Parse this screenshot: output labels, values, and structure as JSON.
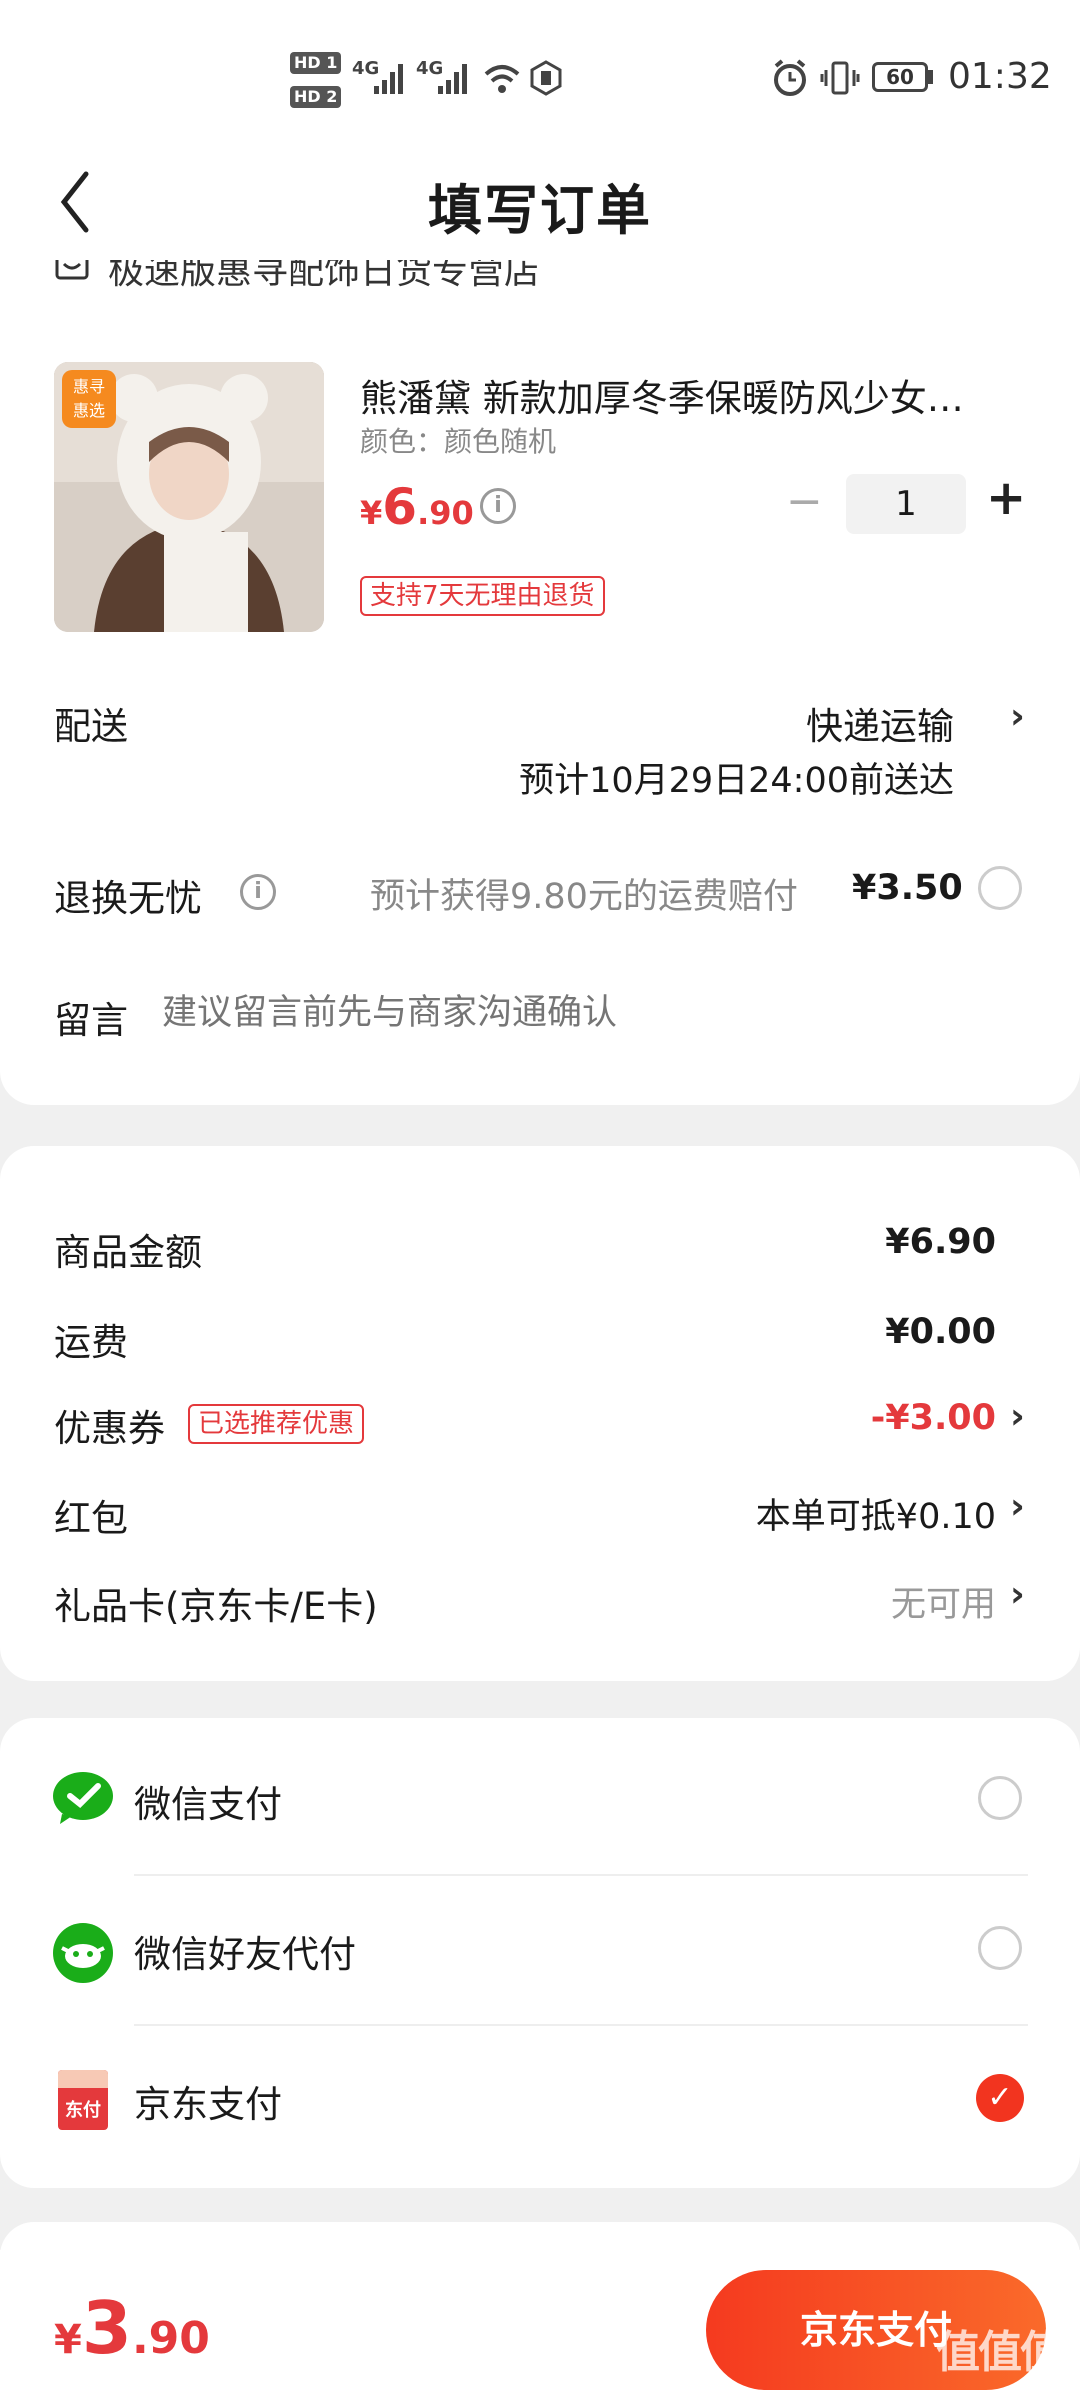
{
  "status_bar": {
    "hd1": "HD 1",
    "hd2": "HD 2",
    "net1": "4G",
    "net2": "4G",
    "battery": "60",
    "time": "01:32"
  },
  "header": {
    "title": "填写订单"
  },
  "store": {
    "name": "极速版惠寻配饰日货专营店"
  },
  "product": {
    "badge": "惠寻\n惠选",
    "name": "熊潘黛 新款加厚冬季保暖防风少女…",
    "spec": "颜色：颜色随机",
    "price_symbol": "¥",
    "price_int": "6",
    "price_dec": ".90",
    "quantity": "1",
    "minus": "−",
    "plus": "+",
    "return_tag": "支持7天无理由退货"
  },
  "delivery": {
    "label": "配送",
    "method": "快递运输",
    "eta": "预计10月29日24:00前送达"
  },
  "return_worry": {
    "label": "退换无忧",
    "desc": "预计获得9.80元的运费赔付",
    "price": "¥3.50"
  },
  "message": {
    "label": "留言",
    "placeholder": "建议留言前先与商家沟通确认"
  },
  "summary": {
    "goods_label": "商品金额",
    "goods_value": "¥6.90",
    "shipping_label": "运费",
    "shipping_value": "¥0.00",
    "coupon_label": "优惠券",
    "coupon_tag": "已选推荐优惠",
    "coupon_value": "-¥3.00",
    "redpacket_label": "红包",
    "redpacket_value": "本单可抵¥0.10",
    "giftcard_label": "礼品卡(京东卡/E卡)",
    "giftcard_value": "无可用"
  },
  "payment": {
    "options": [
      {
        "label": "微信支付",
        "icon": "wechat-pay-icon",
        "selected": false
      },
      {
        "label": "微信好友代付",
        "icon": "wechat-friend-pay-icon",
        "selected": false
      },
      {
        "label": "京东支付",
        "icon": "jd-pay-icon",
        "selected": true
      }
    ],
    "jd_icon_text": "东付"
  },
  "bottom": {
    "total_symbol": "¥",
    "total_int": "3",
    "total_dec": ".90",
    "pay_button": "京东支付",
    "watermark": "值值值"
  },
  "colors": {
    "accent": "#e4393c",
    "wechat": "#1aad19",
    "button": "#f53a1f"
  }
}
